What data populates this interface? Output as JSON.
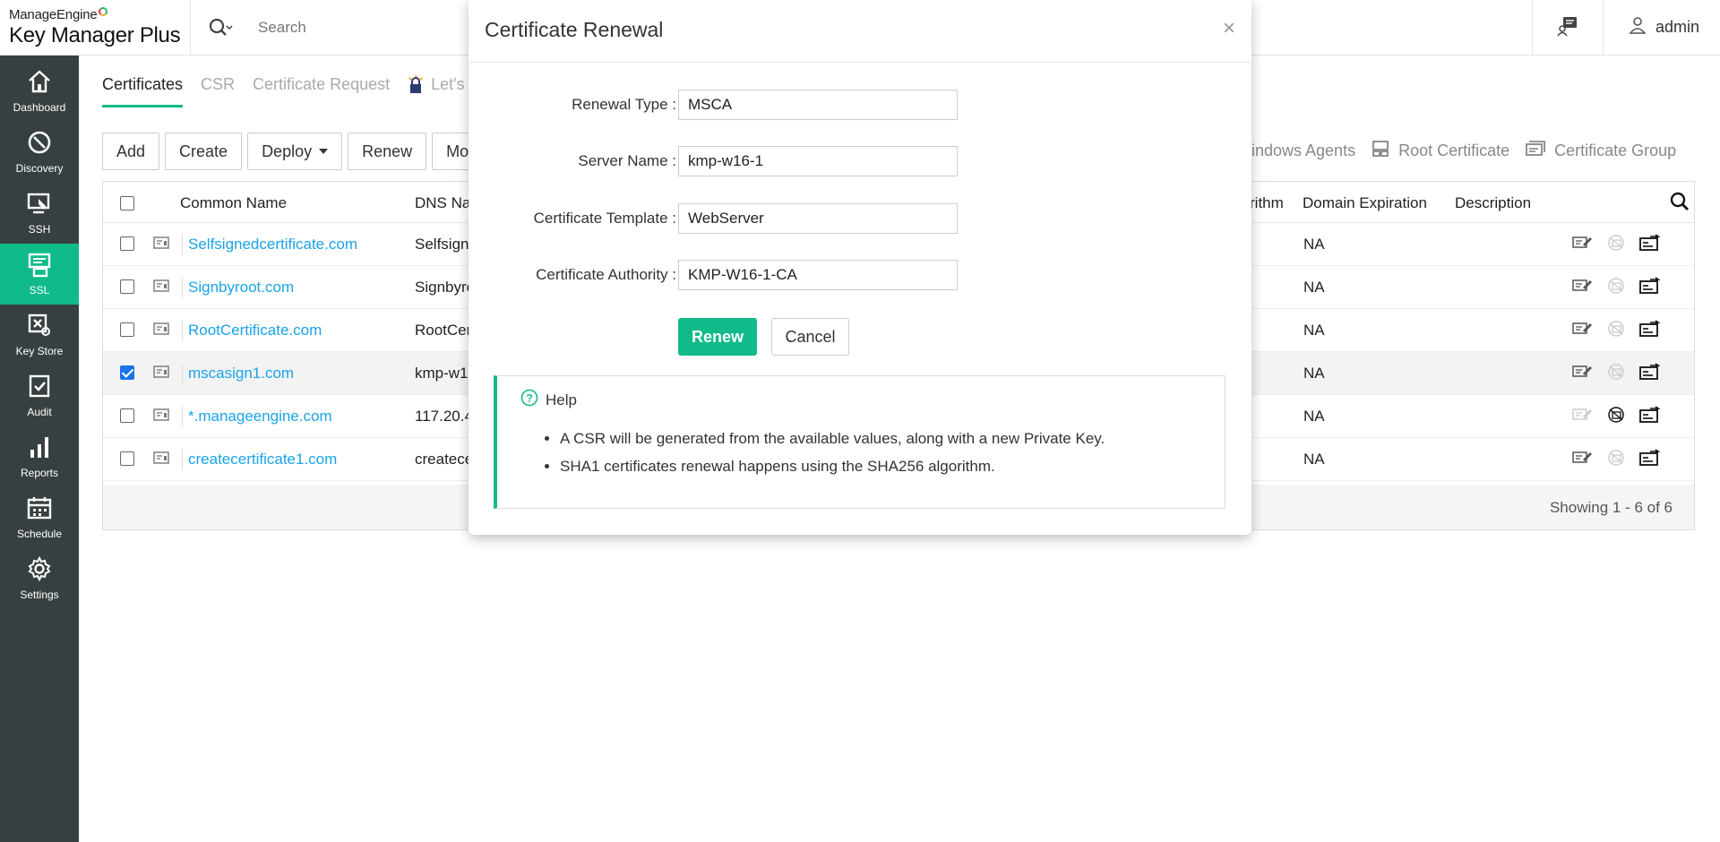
{
  "header": {
    "brand_company": "ManageEngine",
    "brand_product": "Key Manager Plus",
    "search_placeholder": "Search",
    "user": "admin"
  },
  "sidebar": {
    "items": [
      {
        "label": "Dashboard",
        "icon": "home-icon"
      },
      {
        "label": "Discovery",
        "icon": "discovery-icon"
      },
      {
        "label": "SSH",
        "icon": "ssh-icon"
      },
      {
        "label": "SSL",
        "icon": "ssl-icon",
        "active": true
      },
      {
        "label": "Key Store",
        "icon": "key-store-icon"
      },
      {
        "label": "Audit",
        "icon": "audit-icon"
      },
      {
        "label": "Reports",
        "icon": "reports-icon"
      },
      {
        "label": "Schedule",
        "icon": "schedule-icon"
      },
      {
        "label": "Settings",
        "icon": "settings-icon"
      }
    ]
  },
  "tabs": [
    "Certificates",
    "CSR",
    "Certificate Request",
    "Let's E"
  ],
  "toolbar": {
    "add": "Add",
    "create": "Create",
    "deploy": "Deploy",
    "renew": "Renew",
    "more": "Mor"
  },
  "right_links": [
    "Windows Agents",
    "Root Certificate",
    "Certificate Group"
  ],
  "table": {
    "headers": {
      "common_name": "Common Name",
      "dns_name": "DNS Na",
      "algorithm": "rithm",
      "domain_expiration": "Domain Expiration",
      "description": "Description"
    },
    "rows": [
      {
        "common_name": "Selfsignedcertificate.com",
        "dns": "Selfsign",
        "domain_expiration": "NA",
        "checked": false
      },
      {
        "common_name": "Signbyroot.com",
        "dns": "Signbyro",
        "domain_expiration": "NA",
        "checked": false
      },
      {
        "common_name": "RootCertificate.com",
        "dns": "RootCer",
        "domain_expiration": "NA",
        "checked": false
      },
      {
        "common_name": "mscasign1.com",
        "dns": "kmp-w1",
        "domain_expiration": "NA",
        "checked": true
      },
      {
        "common_name": "*.manageengine.com",
        "dns": "117.20.4",
        "domain_expiration": "NA",
        "checked": false
      },
      {
        "common_name": "createcertificate1.com",
        "dns": "createce",
        "domain_expiration": "NA",
        "checked": false
      }
    ],
    "footer": "Showing 1 - 6 of 6"
  },
  "modal": {
    "title": "Certificate Renewal",
    "close": "×",
    "fields": [
      {
        "label": "Renewal Type :",
        "value": "MSCA"
      },
      {
        "label": "Server Name :",
        "value": "kmp-w16-1"
      },
      {
        "label": "Certificate Template :",
        "value": "WebServer"
      },
      {
        "label": "Certificate Authority :",
        "value": "KMP-W16-1-CA"
      }
    ],
    "renew_label": "Renew",
    "cancel_label": "Cancel",
    "help": {
      "title": "Help",
      "items": [
        "A CSR will be generated from the available values, along with a new Private Key.",
        "SHA1 certificates renewal happens using the SHA256 algorithm."
      ]
    }
  },
  "colors": {
    "accent": "#11ba8a",
    "sidebar": "#374040",
    "link": "#1aa3e8"
  }
}
